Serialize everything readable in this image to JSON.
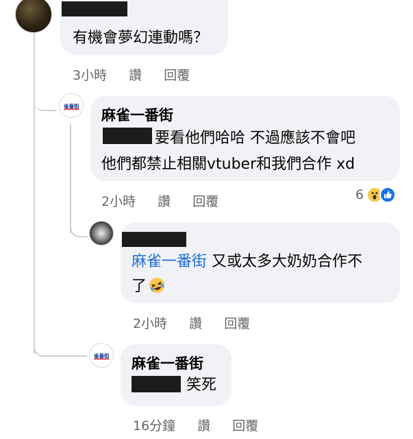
{
  "comments": [
    {
      "author": "",
      "text": "有機會夢幻連動嗎？",
      "time": "3小時",
      "like_label": "讚",
      "reply_label": "回覆"
    },
    {
      "author": "麻雀一番街",
      "line1": "要看他們哈哈 不過應該不會吧",
      "line2": "他們都禁止相關vtuber和我們合作 xd",
      "time": "2小時",
      "like_label": "讚",
      "reply_label": "回覆",
      "reaction_count": "6",
      "reaction_icons": [
        "wow-emoji-icon",
        "like-icon"
      ]
    },
    {
      "author": "",
      "mention": "麻雀一番街",
      "line1_rest": " 又或太多大奶奶合作不",
      "line2": "了",
      "emoji": "laughing-emoji-icon",
      "time": "2小時",
      "like_label": "讚",
      "reply_label": "回覆"
    },
    {
      "author": "麻雀一番街",
      "text": "笑死",
      "time": "16分鐘",
      "like_label": "讚",
      "reply_label": "回覆"
    }
  ],
  "colors": {
    "bubble": "#f0f2f5",
    "meta": "#65676b",
    "mention": "#216fdb",
    "thread_line": "#ced0d4"
  }
}
